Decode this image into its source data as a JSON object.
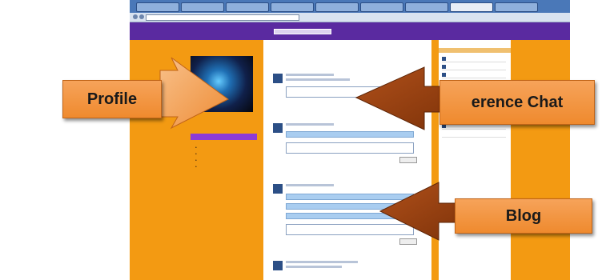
{
  "annotations": {
    "profile": "Profile",
    "conference_chat": "erence Chat",
    "blog": "Blog"
  },
  "colors": {
    "background": "#f39a12",
    "header": "#5a2aa0",
    "callout": "#ef8a2e",
    "arrow": "#8e3d0c"
  }
}
